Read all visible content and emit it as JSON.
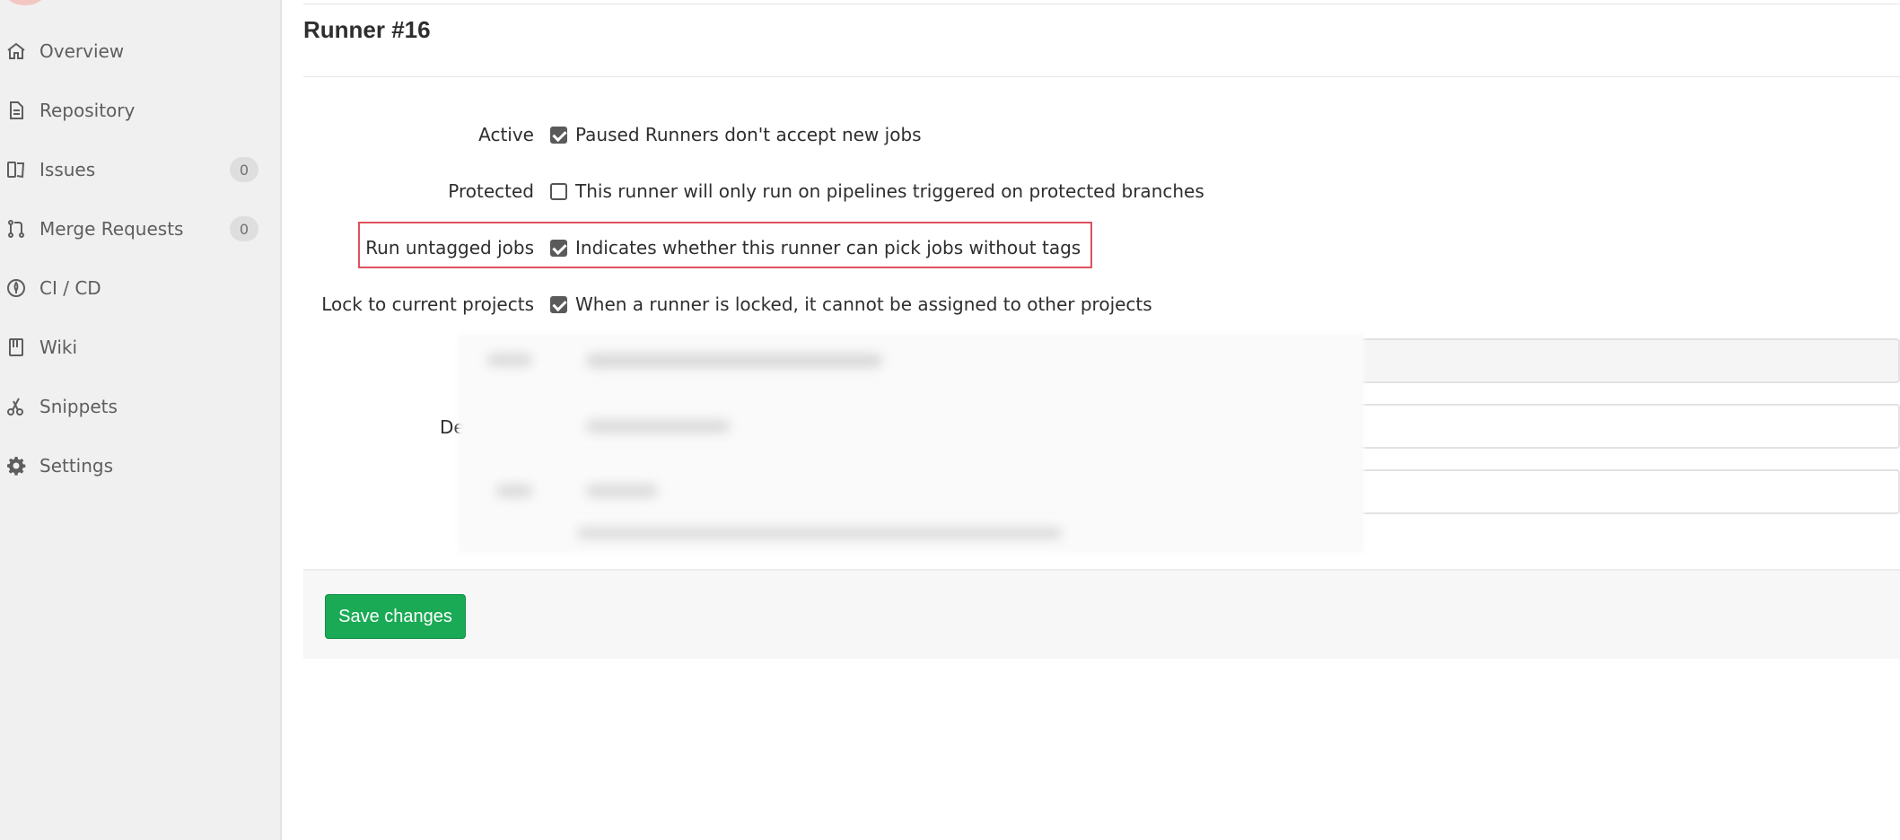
{
  "sidebar": {
    "items": [
      {
        "label": "Overview",
        "icon": "home-icon"
      },
      {
        "label": "Repository",
        "icon": "document-icon"
      },
      {
        "label": "Issues",
        "icon": "issues-icon",
        "badge": "0"
      },
      {
        "label": "Merge Requests",
        "icon": "git-merge-icon",
        "badge": "0"
      },
      {
        "label": "CI / CD",
        "icon": "rocket-icon"
      },
      {
        "label": "Wiki",
        "icon": "book-icon"
      },
      {
        "label": "Snippets",
        "icon": "scissors-icon"
      },
      {
        "label": "Settings",
        "icon": "gear-icon"
      }
    ]
  },
  "page": {
    "title": "Runner #16"
  },
  "form": {
    "active": {
      "label": "Active",
      "checked": true,
      "help": "Paused Runners don't accept new jobs"
    },
    "protected": {
      "label": "Protected",
      "checked": false,
      "help": "This runner will only run on pipelines triggered on protected branches"
    },
    "run_untagged": {
      "label": "Run untagged jobs",
      "checked": true,
      "help": "Indicates whether this runner can pick jobs without tags"
    },
    "locked": {
      "label": "Lock to current projects",
      "checked": true,
      "help": "When a runner is locked, it cannot be assigned to other projects"
    },
    "description_label_visible": "De"
  },
  "footer": {
    "save_label": "Save changes"
  },
  "colors": {
    "save_button": "#1aaa55",
    "highlight": "#e0505e",
    "sidebar_bg": "#f0f0f0"
  }
}
